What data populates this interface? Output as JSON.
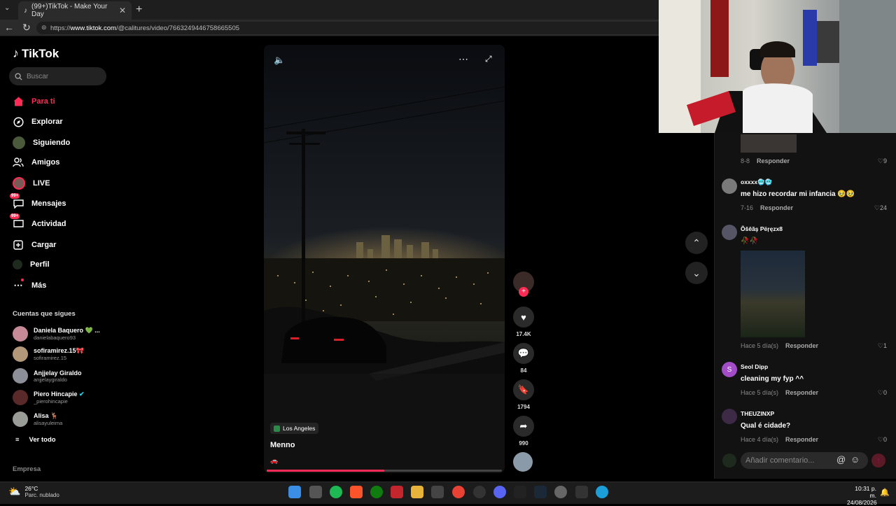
{
  "browser": {
    "tab_title": "(99+)TikTok - Make Your Day",
    "url_prefix": "https://",
    "url_domain": "www.tiktok.com",
    "url_path": "/@calitures/video/7663249446758665505"
  },
  "sidebar": {
    "logo": "TikTok",
    "search_placeholder": "Buscar",
    "nav": [
      {
        "label": "Para ti",
        "icon": "home-icon"
      },
      {
        "label": "Explorar",
        "icon": "compass-icon"
      },
      {
        "label": "Siguiendo",
        "icon": "following-avatar-icon"
      },
      {
        "label": "Amigos",
        "icon": "friends-icon"
      },
      {
        "label": "LIVE",
        "icon": "live-icon"
      },
      {
        "label": "Mensajes",
        "icon": "messages-icon",
        "badge": "99+"
      },
      {
        "label": "Actividad",
        "icon": "activity-icon",
        "badge": "99+"
      },
      {
        "label": "Cargar",
        "icon": "upload-icon"
      },
      {
        "label": "Perfil",
        "icon": "profile-icon"
      },
      {
        "label": "Más",
        "icon": "more-icon"
      }
    ],
    "following_title": "Cuentas que sigues",
    "accounts": [
      {
        "name": "Daniela Baquero 💚 ...",
        "handle": "danielabaquero93"
      },
      {
        "name": "sofiramirez.15🎀",
        "handle": "sofiramirez.15"
      },
      {
        "name": "Anjjelay Giraldo",
        "handle": "anjjelaygiraldo"
      },
      {
        "name": "Piero Hincapie",
        "handle": "_pierohincapie"
      },
      {
        "name": "Alisa 🦌",
        "handle": "alisayuleima"
      }
    ],
    "see_all": "Ver todo",
    "company": "Empresa"
  },
  "video": {
    "location": "Los Angeles",
    "author": "Menno",
    "progress": 0.5
  },
  "actions": {
    "likes": "17.4K",
    "comments": "84",
    "saves": "1794",
    "shares": "990"
  },
  "comments": [
    {
      "meta_date": "8-8",
      "reply": "Responder",
      "likes": "9"
    },
    {
      "name": "oxxxx🥶🥶",
      "text": "me hizo recordar mi infancia 🥹🥹",
      "meta_date": "7-16",
      "reply": "Responder",
      "likes": "24"
    },
    {
      "name": "Õšêãş Pëŗęzx8",
      "text": "🥀🥀",
      "meta_date": "Hace 5 día(s)",
      "reply": "Responder",
      "likes": "1"
    },
    {
      "name": "Seol Dipp",
      "initial": "S",
      "text": "cleaning my fyp ^^",
      "meta_date": "Hace 5 día(s)",
      "reply": "Responder",
      "likes": "0"
    },
    {
      "name": "THEUZINXP",
      "text": "Qual é cidade?",
      "meta_date": "Hace 4 día(s)",
      "reply": "Responder",
      "likes": "0"
    }
  ],
  "comment_input": {
    "placeholder": "Añadir comentario..."
  },
  "taskbar": {
    "temperature": "26°C",
    "weather": "Parc. nublado",
    "time": "10:31 p. m.",
    "date": "24/08/2026"
  },
  "colors": {
    "accent": "#fe2c55",
    "background": "#000000",
    "panel": "#121212"
  }
}
